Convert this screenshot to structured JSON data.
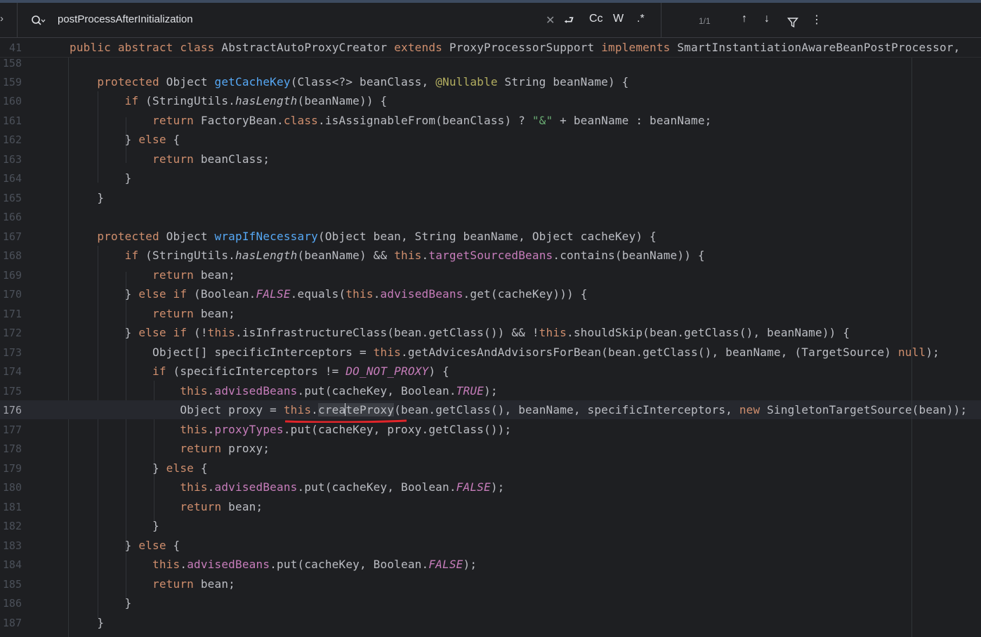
{
  "search": {
    "query": "postProcessAfterInitialization",
    "toggle_glyph": "›",
    "clear_glyph": "✕",
    "options": {
      "replace": "⮐",
      "match_case": "Cc",
      "words": "W",
      "regex": ".*"
    },
    "match_count": "1/1",
    "prev_glyph": "↑",
    "next_glyph": "↓",
    "filter_glyph": "⛛",
    "more_glyph": "⋮"
  },
  "sticky": {
    "line_number": "41",
    "t": [
      "public",
      " ",
      "abstract",
      " ",
      "class",
      " AbstractAutoProxyCreator ",
      "extends",
      " ProxyProcessorSupport ",
      "implements",
      " SmartInstantiationAwareBeanPostProcessor,"
    ]
  },
  "lines": {
    "l158": {
      "n": "158"
    },
    "l159": {
      "n": "159",
      "t": [
        "    ",
        "protected",
        " Object ",
        "getCacheKey",
        "(Class<?> beanClass, ",
        "@Nullable",
        " String beanName) {"
      ]
    },
    "l160": {
      "n": "160",
      "t": [
        "        ",
        "if",
        " (StringUtils.",
        "hasLength",
        "(beanName)) {"
      ]
    },
    "l161": {
      "n": "161",
      "t": [
        "            ",
        "return",
        " FactoryBean.",
        "class",
        ".isAssignableFrom(beanClass) ? ",
        "\"&\"",
        " + beanName : beanName;"
      ]
    },
    "l162": {
      "n": "162",
      "t": [
        "        } ",
        "else",
        " {"
      ]
    },
    "l163": {
      "n": "163",
      "t": [
        "            ",
        "return",
        " beanClass;"
      ]
    },
    "l164": {
      "n": "164",
      "t": [
        "        }"
      ]
    },
    "l165": {
      "n": "165",
      "t": [
        "    }"
      ]
    },
    "l166": {
      "n": "166"
    },
    "l167": {
      "n": "167",
      "t": [
        "    ",
        "protected",
        " Object ",
        "wrapIfNecessary",
        "(Object bean, String beanName, Object cacheKey) {"
      ]
    },
    "l168": {
      "n": "168",
      "t": [
        "        ",
        "if",
        " (StringUtils.",
        "hasLength",
        "(beanName) && ",
        "this",
        ".",
        "targetSourcedBeans",
        ".contains(beanName)) {"
      ]
    },
    "l169": {
      "n": "169",
      "t": [
        "            ",
        "return",
        " bean;"
      ]
    },
    "l170": {
      "n": "170",
      "t": [
        "        } ",
        "else if",
        " (Boolean.",
        "FALSE",
        ".equals(",
        "this",
        ".",
        "advisedBeans",
        ".get(cacheKey))) {"
      ]
    },
    "l171": {
      "n": "171",
      "t": [
        "            ",
        "return",
        " bean;"
      ]
    },
    "l172": {
      "n": "172",
      "t": [
        "        } ",
        "else if",
        " (!",
        "this",
        ".isInfrastructureClass(bean.getClass()) && !",
        "this",
        ".shouldSkip(bean.getClass(), beanName)) {"
      ]
    },
    "l173": {
      "n": "173",
      "t": [
        "            Object[] specificInterceptors = ",
        "this",
        ".getAdvicesAndAdvisorsForBean(bean.getClass(), beanName, (TargetSource) ",
        "null",
        ");"
      ]
    },
    "l174": {
      "n": "174",
      "t": [
        "            ",
        "if",
        " (specificInterceptors != ",
        "DO_NOT_PROXY",
        ") {"
      ]
    },
    "l175": {
      "n": "175",
      "t": [
        "                ",
        "this",
        ".",
        "advisedBeans",
        ".put(cacheKey, Boolean.",
        "TRUE",
        ");"
      ]
    },
    "l176": {
      "n": "176",
      "t": [
        "                Object proxy = ",
        "this",
        ".",
        "crea",
        "teProxy",
        "(bean.getClass(), beanName, specificInterceptors, ",
        "new",
        " SingletonTargetSource(bean));"
      ]
    },
    "l177": {
      "n": "177",
      "t": [
        "                ",
        "this",
        ".",
        "proxyTypes",
        ".put(cacheKey, proxy.getClass());"
      ]
    },
    "l178": {
      "n": "178",
      "t": [
        "                ",
        "return",
        " proxy;"
      ]
    },
    "l179": {
      "n": "179",
      "t": [
        "            } ",
        "else",
        " {"
      ]
    },
    "l180": {
      "n": "180",
      "t": [
        "                ",
        "this",
        ".",
        "advisedBeans",
        ".put(cacheKey, Boolean.",
        "FALSE",
        ");"
      ]
    },
    "l181": {
      "n": "181",
      "t": [
        "                ",
        "return",
        " bean;"
      ]
    },
    "l182": {
      "n": "182",
      "t": [
        "            }"
      ]
    },
    "l183": {
      "n": "183",
      "t": [
        "        } ",
        "else",
        " {"
      ]
    },
    "l184": {
      "n": "184",
      "t": [
        "            ",
        "this",
        ".",
        "advisedBeans",
        ".put(cacheKey, Boolean.",
        "FALSE",
        ");"
      ]
    },
    "l185": {
      "n": "185",
      "t": [
        "            ",
        "return",
        " bean;"
      ]
    },
    "l186": {
      "n": "186",
      "t": [
        "        }"
      ]
    },
    "l187": {
      "n": "187",
      "t": [
        "    }"
      ]
    }
  },
  "colors": {
    "background": "#1e1f22",
    "keyword": "#cf8e6d",
    "method_declaration": "#56a8f5",
    "field_and_constant": "#c77dbb",
    "string": "#6aab73",
    "annotation": "#b3ae60",
    "plain": "#bcbec4",
    "annotation_underline": "#e0252a"
  },
  "annotation": {
    "kind": "red-underline",
    "target": "this.createProxy"
  },
  "current_line": "176"
}
